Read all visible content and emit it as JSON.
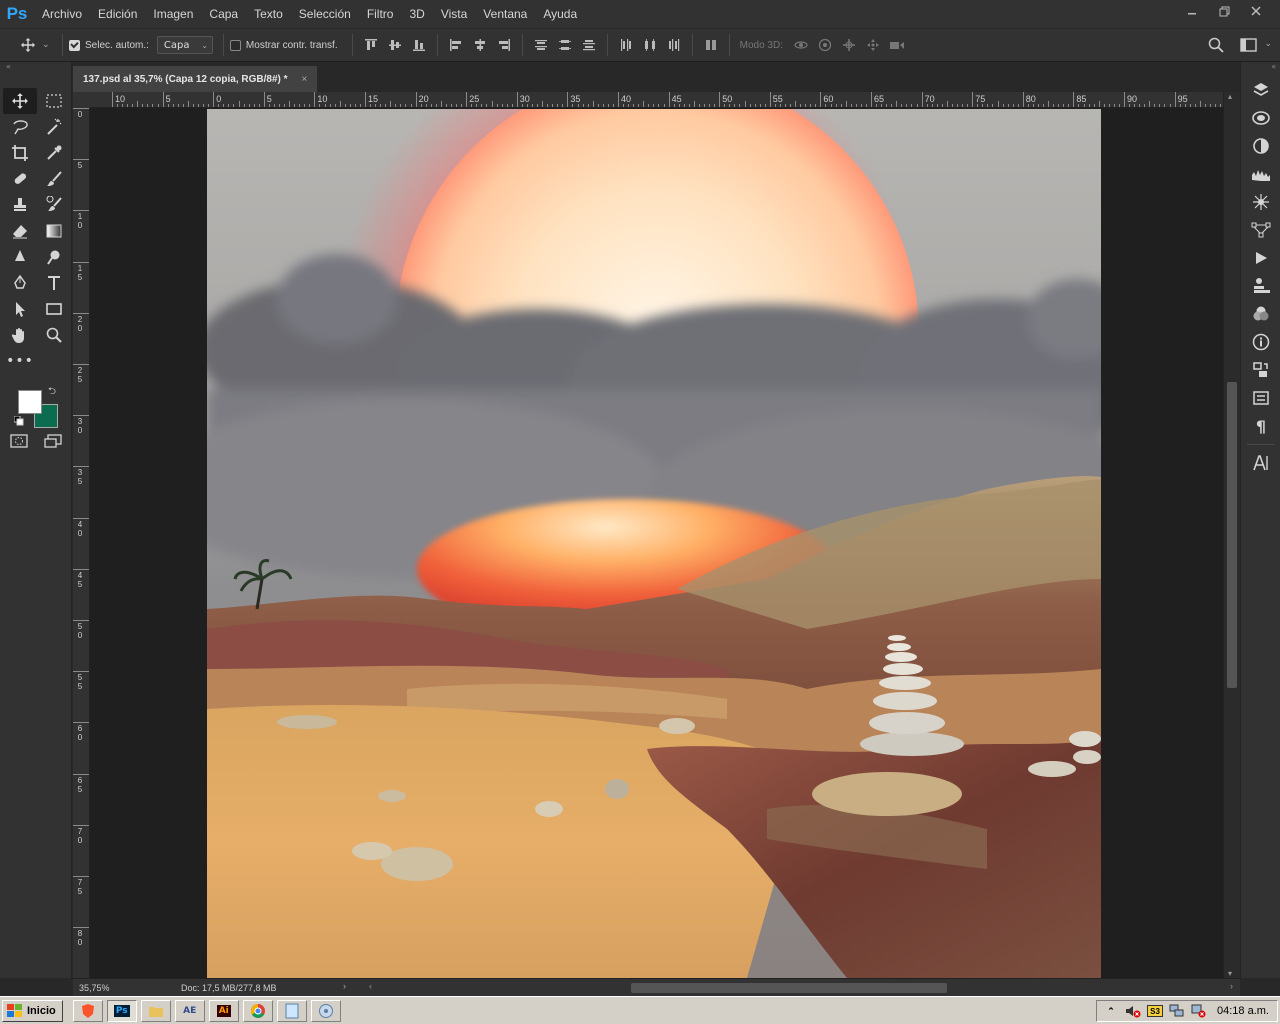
{
  "app": {
    "logo": "Ps"
  },
  "menu": [
    "Archivo",
    "Edición",
    "Imagen",
    "Capa",
    "Texto",
    "Selección",
    "Filtro",
    "3D",
    "Vista",
    "Ventana",
    "Ayuda"
  ],
  "window_controls": [
    "minimize-icon",
    "restore-icon",
    "close-icon"
  ],
  "options": {
    "auto_select_label": "Selec. autom.:",
    "auto_select_checked": true,
    "layer_select_value": "Capa",
    "show_transform_label": "Mostrar contr. transf.",
    "show_transform_checked": false,
    "mode3d_label": "Modo 3D:"
  },
  "document": {
    "tab_title": "137.psd al 35,7% (Capa 12 copia, RGB/8#) *",
    "tab_close": "×"
  },
  "ruler": {
    "h_labels": [
      "10",
      "5",
      "0",
      "5",
      "10",
      "15",
      "20",
      "25",
      "30",
      "35",
      "40",
      "45",
      "50",
      "55",
      "60",
      "65",
      "70",
      "75",
      "80",
      "85",
      "90",
      "95"
    ],
    "v_labels": [
      "0",
      "5",
      "1 0",
      "1 5",
      "2 0",
      "2 5",
      "3 0",
      "3 5",
      "4 0",
      "4 5",
      "5 0",
      "5 5",
      "6 0",
      "6 5",
      "7 0",
      "7 5",
      "8 0",
      "8 5"
    ]
  },
  "tools": [
    "move-tool",
    "marquee-tool",
    "lasso-tool",
    "magic-wand-tool",
    "crop-tool",
    "eyedropper-tool",
    "healing-tool",
    "brush-tool",
    "stamp-tool",
    "history-brush-tool",
    "eraser-tool",
    "gradient-tool",
    "blur-tool",
    "dodge-tool",
    "pen-tool",
    "type-tool",
    "path-select-tool",
    "rectangle-tool",
    "hand-tool",
    "zoom-tool"
  ],
  "colors": {
    "foreground": "#ffffff",
    "background": "#0b6c4f"
  },
  "status": {
    "zoom": "35,75%",
    "doc_info": "Doc: 17,5 MB/277,8 MB"
  },
  "right_panel": [
    "layers-icon",
    "channels-icon",
    "adjustments-icon",
    "histogram-icon",
    "navigator-icon",
    "paths-icon",
    "actions-icon",
    "clone-source-icon",
    "swatches-icon",
    "info-icon",
    "history-icon",
    "properties-icon",
    "paragraph-icon",
    "character-icon"
  ],
  "taskbar": {
    "start_label": "Inicio",
    "apps": [
      "brave",
      "photoshop",
      "explorer",
      "after-effects",
      "illustrator",
      "chrome",
      "notepad",
      "disk-tool"
    ],
    "app_labels": {
      "ps": "Ps",
      "ae": "AE",
      "ai": "Ai"
    },
    "time": "04:18 a.m."
  }
}
